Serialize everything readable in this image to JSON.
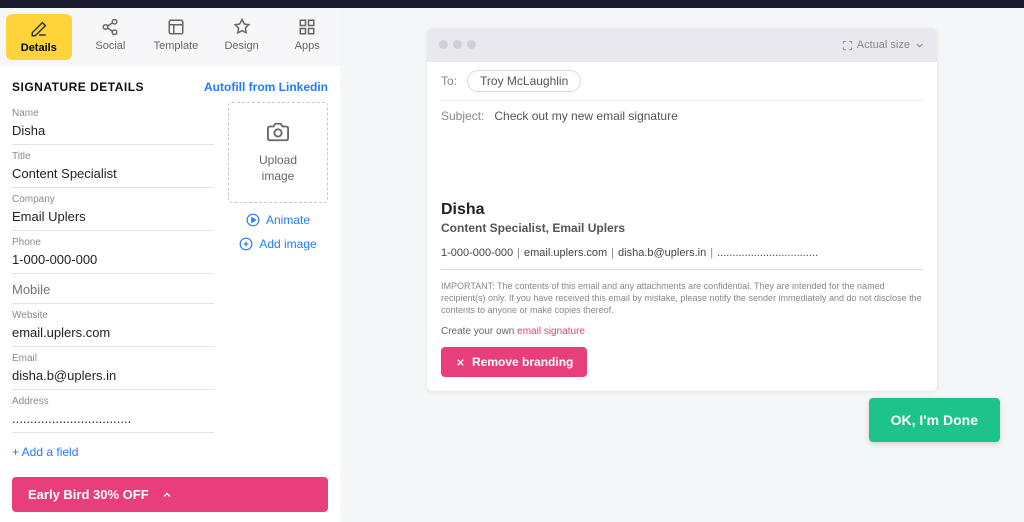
{
  "tabs": {
    "details": "Details",
    "social": "Social",
    "template": "Template",
    "design": "Design",
    "apps": "Apps"
  },
  "section": {
    "title": "SIGNATURE DETAILS",
    "linkedin": "Autofill from Linkedin"
  },
  "fields": {
    "name": {
      "label": "Name",
      "value": "Disha"
    },
    "title": {
      "label": "Title",
      "value": "Content Specialist"
    },
    "company": {
      "label": "Company",
      "value": "Email Uplers"
    },
    "phone": {
      "label": "Phone",
      "value": "1-000-000-000"
    },
    "mobile": {
      "label": "Mobile",
      "value": ""
    },
    "website": {
      "label": "Website",
      "value": "email.uplers.com"
    },
    "email": {
      "label": "Email",
      "value": "disha.b@uplers.in"
    },
    "address": {
      "label": "Address",
      "value": "................................."
    }
  },
  "imgbox": {
    "upload_line1": "Upload",
    "upload_line2": "image",
    "animate": "Animate",
    "add": "Add image"
  },
  "add_field": "+ Add a field",
  "promo": "Early Bird 30% OFF",
  "preview": {
    "actual_size": "Actual size",
    "to_label": "To:",
    "to_value": "Troy McLaughlin",
    "subject_label": "Subject:",
    "subject_value": "Check out my new email signature",
    "sig": {
      "name": "Disha",
      "title": "Content Specialist, Email Uplers",
      "phone": "1-000-000-000",
      "website": "email.uplers.com",
      "email": "disha.b@uplers.in",
      "address": "................................."
    },
    "disclaimer": "IMPORTANT: The contents of this email and any attachments are confidential. They are intended for the named recipient(s) only. If you have received this email by mistake, please notify the sender immediately and do not disclose the contents to anyone or make copies thereof.",
    "cyo_text": "Create your own ",
    "cyo_link": "email signature",
    "remove": "Remove branding"
  },
  "ok_button": "OK, I'm Done"
}
